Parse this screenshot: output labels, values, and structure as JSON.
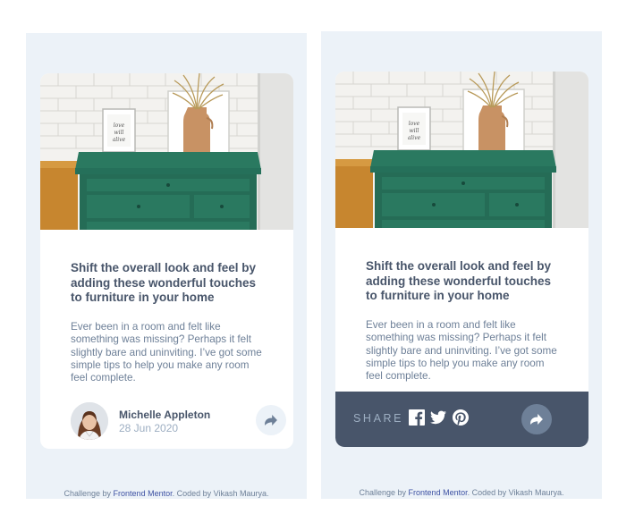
{
  "article": {
    "headline_lines": [
      "Shift the overall look and feel by",
      "adding these wonderful touches",
      "to furniture in your home"
    ],
    "description_lines": [
      "Ever been in a room and felt like",
      "something was missing? Perhaps it felt",
      "slightly bare and uninviting. I’ve got some",
      "simple tips to help you make any room",
      "feel complete."
    ]
  },
  "author": {
    "name": "Michelle Appleton",
    "date": "28 Jun 2020"
  },
  "share": {
    "label": "SHARE",
    "networks": [
      "facebook-icon",
      "twitter-icon",
      "pinterest-icon"
    ]
  },
  "attribution": {
    "prefix": "Challenge by ",
    "link_text": "Frontend Mentor",
    "suffix": ". Coded by Vikash Maurya."
  },
  "colors": {
    "background": "#ecf2f8",
    "dark_text": "#48556a",
    "muted_text": "#6e8098",
    "light_text": "#9daec2",
    "share_bar": "#48556a",
    "link": "#3e52a3"
  }
}
